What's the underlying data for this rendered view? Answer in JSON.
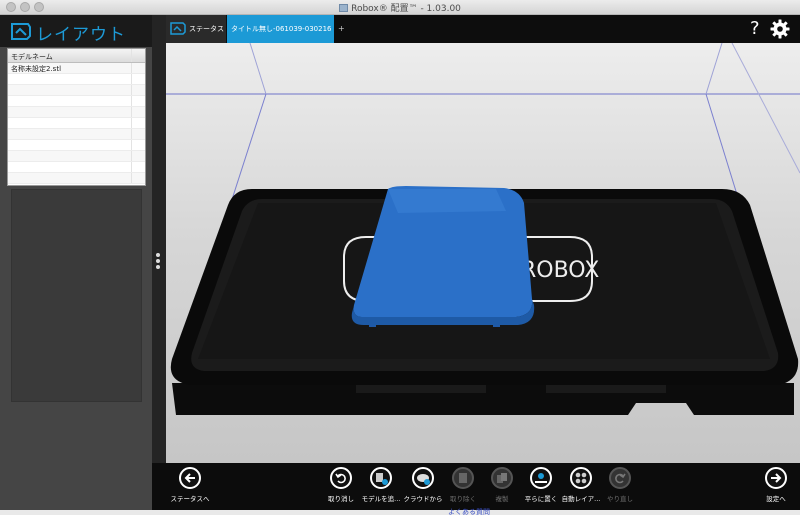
{
  "window": {
    "title": "Robox® 配置™ - 1.03.00"
  },
  "left_panel": {
    "title": "レイアウト",
    "table": {
      "header": "モデルネーム",
      "rows": [
        "名称未設定2.stl",
        "",
        "",
        "",
        "",
        "",
        "",
        "",
        "",
        "",
        ""
      ]
    }
  },
  "tabs": {
    "status_label": "ステータス",
    "project_label": "タイトル無し-061039-030216",
    "add_label": "+"
  },
  "header_icons": {
    "help": "?",
    "settings": "gear-icon"
  },
  "toolbar": {
    "back_label": "ステータスへ",
    "undo_label": "取り消し",
    "add_model_label": "モデルを追...",
    "cloud_label": "クラウドから",
    "remove_label": "取り除く",
    "copy_label": "複製",
    "lay_flat_label": "平らに置く",
    "auto_layout_label": "自動レイア...",
    "redo_label": "やり直し",
    "settings_label": "設定へ"
  },
  "bed_logo_text": "ROBOX",
  "colors": {
    "accent": "#1c9ad6",
    "model": "#2a6fc9"
  },
  "background_link": "よくある質問"
}
